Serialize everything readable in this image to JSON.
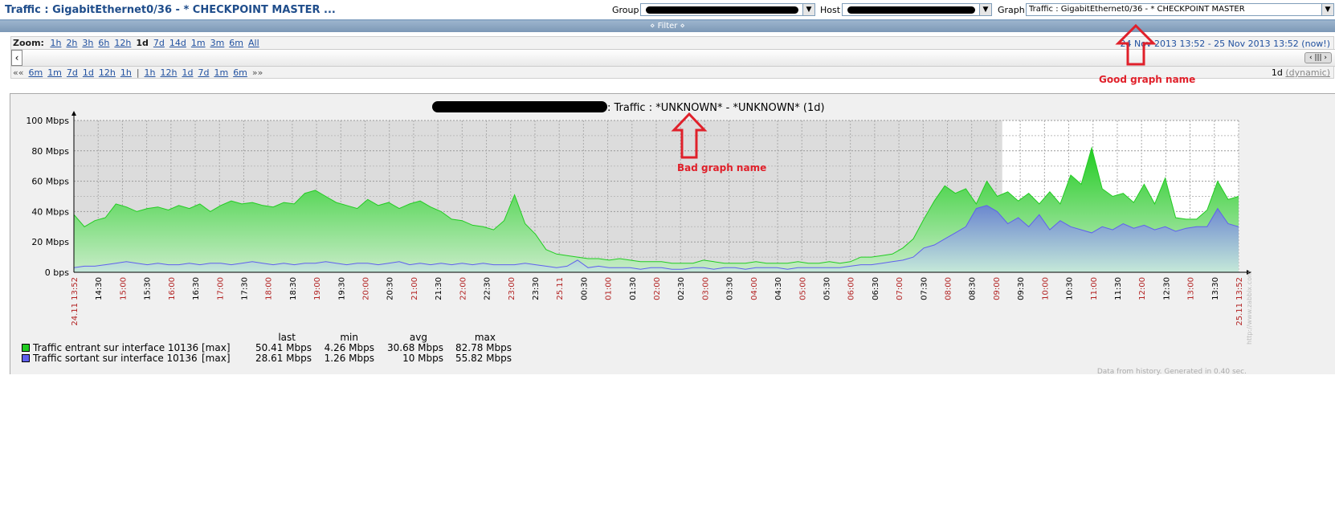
{
  "header": {
    "title": "Traffic : GigabitEthernet0/36 - * CHECKPOINT MASTER ...",
    "group_label": "Group",
    "host_label": "Host",
    "graph_label": "Graph",
    "graph_select_value": "Traffic : GigabitEthernet0/36 - * CHECKPOINT MASTER"
  },
  "filter": {
    "label": "⋄ Filter ⋄"
  },
  "zoom": {
    "label": "Zoom:",
    "options": [
      "1h",
      "2h",
      "3h",
      "6h",
      "12h",
      "1d",
      "7d",
      "14d",
      "1m",
      "3m",
      "6m",
      "All"
    ],
    "active": "1d",
    "date_range": "24 Nov 2013 13:52  -  25 Nov 2013 13:52 (now!)"
  },
  "nav": {
    "back_all": "««",
    "back": [
      "6m",
      "1m",
      "7d",
      "1d",
      "12h",
      "1h"
    ],
    "separator": "|",
    "forward": [
      "1h",
      "12h",
      "1d",
      "7d",
      "1m",
      "6m"
    ],
    "forward_all": "»»",
    "period": "1d",
    "period_mode": "(dynamic)"
  },
  "graph": {
    "title_suffix": ": Traffic : *UNKNOWN* - *UNKNOWN* (1d)",
    "watermark": "http://www.zabbix.com",
    "footer": "Data from history. Generated in 0.40 sec."
  },
  "chart_data": {
    "type": "area",
    "title": ": Traffic : *UNKNOWN* - *UNKNOWN* (1d)",
    "xlabel": "",
    "ylabel": "",
    "ylim": [
      0,
      100
    ],
    "y_unit": "Mbps",
    "y_ticks": [
      "0 bps",
      "20 Mbps",
      "40 Mbps",
      "60 Mbps",
      "80 Mbps",
      "100 Mbps"
    ],
    "x_ticks": [
      "24.11 13:52",
      "14:30",
      "15:00",
      "15:30",
      "16:00",
      "16:30",
      "17:00",
      "17:30",
      "18:00",
      "18:30",
      "19:00",
      "19:30",
      "20:00",
      "20:30",
      "21:00",
      "21:30",
      "22:00",
      "22:30",
      "23:00",
      "23:30",
      "25.11",
      "00:30",
      "01:00",
      "01:30",
      "02:00",
      "02:30",
      "03:00",
      "03:30",
      "04:00",
      "04:30",
      "05:00",
      "05:30",
      "06:00",
      "06:30",
      "07:00",
      "07:30",
      "08:00",
      "08:30",
      "09:00",
      "09:30",
      "10:00",
      "10:30",
      "11:00",
      "11:30",
      "12:00",
      "12:30",
      "13:00",
      "13:30",
      "25.11 13:52"
    ],
    "red_ticks": [
      "24.11 13:52",
      "15:00",
      "16:00",
      "17:00",
      "18:00",
      "19:00",
      "20:00",
      "21:00",
      "22:00",
      "23:00",
      "25.11",
      "01:00",
      "02:00",
      "03:00",
      "04:00",
      "05:00",
      "06:00",
      "07:00",
      "08:00",
      "09:00",
      "10:00",
      "11:00",
      "12:00",
      "13:00",
      "25.11 13:52"
    ],
    "x_hours": [
      0,
      0.5,
      1,
      1.5,
      2,
      2.5,
      3,
      3.5,
      4,
      4.5,
      5,
      5.5,
      6,
      6.5,
      7,
      7.5,
      8,
      8.5,
      9,
      9.5,
      10,
      10.5,
      11,
      11.5,
      12,
      12.5,
      13,
      13.5,
      14,
      14.5,
      15,
      15.5,
      16,
      16.5,
      17,
      17.5,
      18,
      18.5,
      19,
      19.5,
      20,
      20.5,
      21,
      21.5,
      22,
      22.5,
      23,
      23.5,
      24
    ],
    "grid": true,
    "work_hours_from": 19.13,
    "series": [
      {
        "name": "Traffic entrant sur interface 10136",
        "color": "#22cc22",
        "values": [
          38,
          30,
          34,
          36,
          45,
          43,
          40,
          42,
          43,
          41,
          44,
          42,
          45,
          40,
          44,
          47,
          45,
          46,
          44,
          43,
          46,
          45,
          52,
          54,
          50,
          46,
          44,
          42,
          48,
          44,
          46,
          42,
          45,
          47,
          43,
          40,
          35,
          34,
          31,
          30,
          28,
          34,
          51,
          32,
          25,
          15,
          12,
          11,
          10,
          9,
          9,
          8,
          9,
          8,
          7,
          7,
          7,
          6,
          6,
          6,
          8,
          7,
          6,
          6,
          6,
          7,
          6,
          6,
          6,
          7,
          6,
          6,
          7,
          6,
          7,
          10,
          10,
          11,
          12,
          16,
          22,
          35,
          47,
          57,
          52,
          55,
          45,
          60,
          50,
          53,
          47,
          52,
          45,
          53,
          45,
          64,
          58,
          82,
          55,
          50,
          52,
          46,
          58,
          45,
          62,
          36,
          35,
          35,
          41,
          60,
          48,
          50
        ]
      },
      {
        "name": "Traffic sortant sur interface 10136",
        "color": "#6060ee",
        "values": [
          3,
          4,
          4,
          5,
          6,
          7,
          6,
          5,
          6,
          5,
          5,
          6,
          5,
          6,
          6,
          5,
          6,
          7,
          6,
          5,
          6,
          5,
          6,
          6,
          7,
          6,
          5,
          6,
          6,
          5,
          6,
          7,
          5,
          6,
          5,
          6,
          5,
          6,
          5,
          6,
          5,
          5,
          5,
          6,
          5,
          4,
          3,
          4,
          8,
          3,
          4,
          3,
          3,
          3,
          2,
          3,
          3,
          2,
          2,
          3,
          3,
          2,
          3,
          3,
          2,
          3,
          3,
          3,
          2,
          3,
          3,
          3,
          3,
          3,
          4,
          5,
          5,
          6,
          7,
          8,
          10,
          16,
          18,
          22,
          26,
          30,
          42,
          44,
          40,
          32,
          36,
          30,
          38,
          28,
          34,
          30,
          28,
          26,
          30,
          28,
          32,
          29,
          31,
          28,
          30,
          27,
          29,
          30,
          30,
          42,
          32,
          30
        ]
      }
    ],
    "legend": {
      "headers": [
        "last",
        "min",
        "avg",
        "max"
      ],
      "rows": [
        {
          "name": "Traffic entrant sur interface 10136",
          "func": "[max]",
          "last": "50.41 Mbps",
          "min": "4.26 Mbps",
          "avg": "30.68 Mbps",
          "max": "82.78 Mbps",
          "color": "#22cc22"
        },
        {
          "name": "Traffic sortant sur interface 10136",
          "func": "[max]",
          "last": "28.61 Mbps",
          "min": "1.26 Mbps",
          "avg": "10 Mbps",
          "max": "55.82 Mbps",
          "color": "#6060ee"
        }
      ]
    }
  },
  "annotations": {
    "good": "Good graph name",
    "bad": "Bad graph name"
  }
}
